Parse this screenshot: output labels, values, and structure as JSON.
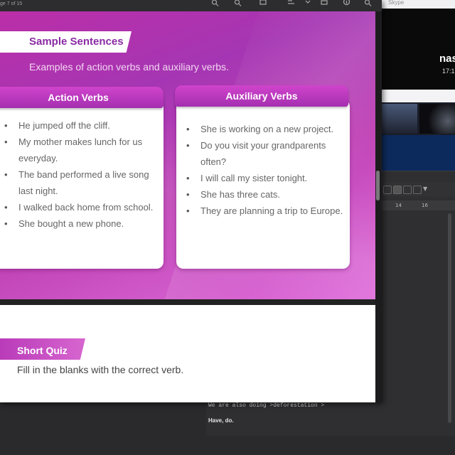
{
  "viewer": {
    "page_counter": "ge 7 of 15"
  },
  "slide": {
    "title": "Sample Sentences",
    "subtitle": "Examples of action verbs and auxiliary verbs.",
    "action": {
      "heading": "Action Verbs",
      "items": [
        "He jumped off the cliff.",
        "My mother makes lunch for us everyday.",
        "The band performed a live song last night.",
        "I walked back home from school.",
        "She bought a new phone."
      ]
    },
    "auxiliary": {
      "heading": "Auxiliary Verbs",
      "items": [
        "She is working on a new project.",
        "Do you visit your grandparents often?",
        "I will call my sister tonight.",
        "She has three cats.",
        "They are planning a trip to Europe."
      ]
    }
  },
  "quiz": {
    "title": "Short Quiz",
    "text": "Fill in the blanks with the correct verb."
  },
  "skype": {
    "window_title": "Skype",
    "name": "nas",
    "time": "17:1"
  },
  "editor": {
    "ruler_14": "14",
    "ruler_16": "16",
    "line1": "We are also doing  >deforestation >",
    "line2": "Have, do."
  },
  "icons": [
    "search-icon",
    "zoom-icon",
    "square-icon",
    "pen-icon",
    "share-icon",
    "info-icon",
    "search-icon-2"
  ],
  "colors": {
    "slide_accent": "#a536b3",
    "banner_text": "#8a2aa4"
  }
}
